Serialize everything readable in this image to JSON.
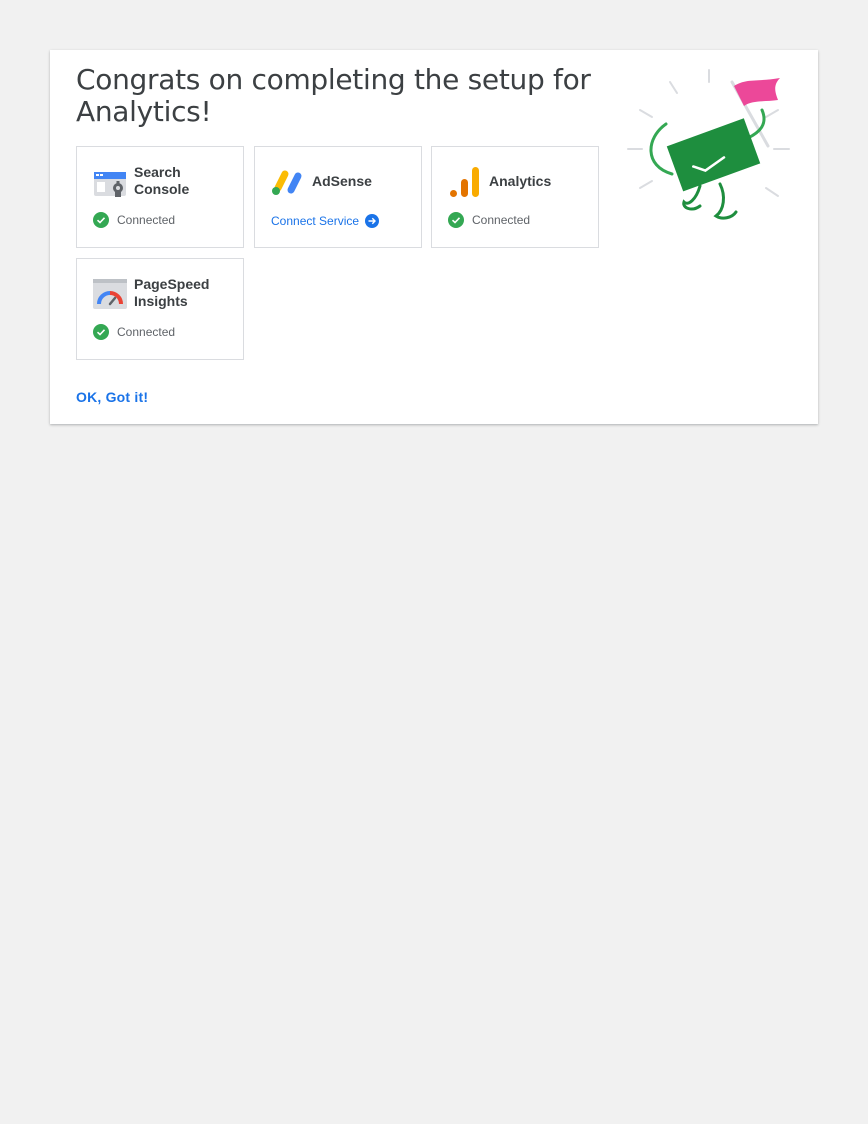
{
  "page": {
    "title": "Congrats on completing the setup for Analytics!"
  },
  "services": [
    {
      "name": "Search Console",
      "icon": "search-console-icon",
      "status": "Connected"
    },
    {
      "name": "AdSense",
      "icon": "adsense-icon",
      "action": "Connect Service"
    },
    {
      "name": "Analytics",
      "icon": "analytics-icon",
      "status": "Connected"
    },
    {
      "name": "PageSpeed Insights",
      "icon": "pagespeed-insights-icon",
      "status": "Connected"
    }
  ],
  "actions": {
    "ok_label": "OK, Got it!"
  },
  "colors": {
    "accent": "#1a73e8",
    "connected": "#34a853",
    "flag": "#ec4899",
    "celebration_green": "#1e8e3e"
  }
}
